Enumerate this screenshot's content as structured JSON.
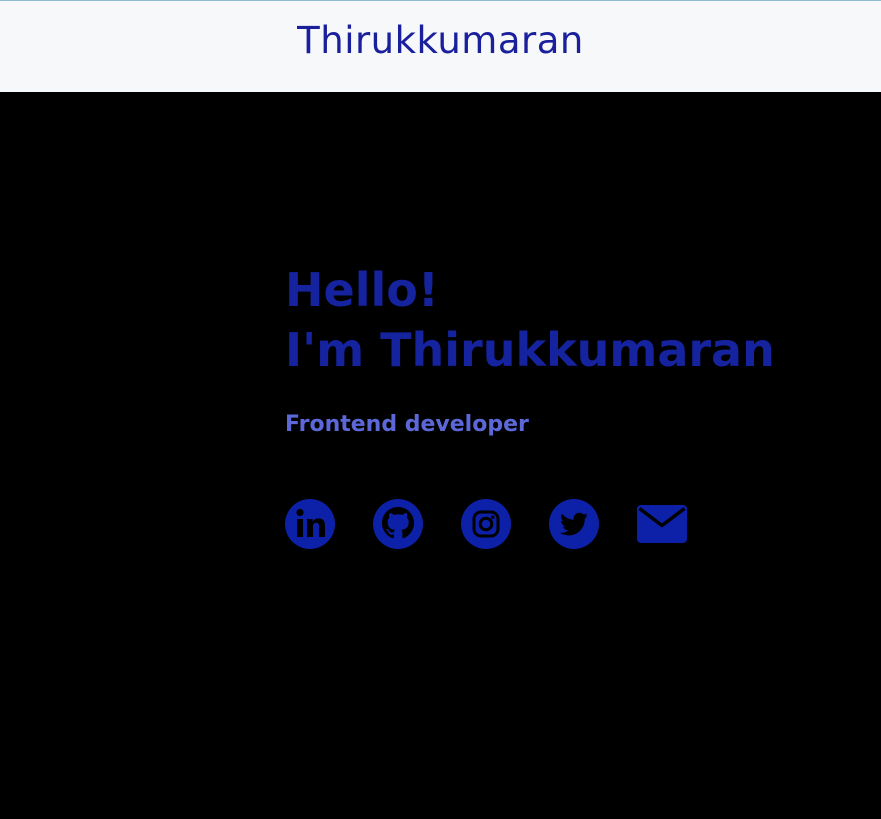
{
  "header": {
    "brand": "Thirukkumaran"
  },
  "hero": {
    "greeting_line1": "Hello!",
    "greeting_line2": "I'm Thirukkumaran",
    "role": "Frontend developer"
  },
  "socials": [
    {
      "icon": "linkedin-icon"
    },
    {
      "icon": "github-icon"
    },
    {
      "icon": "instagram-icon"
    },
    {
      "icon": "twitter-icon"
    },
    {
      "icon": "email-icon"
    }
  ],
  "colors": {
    "header_bg": "#f7f8fa",
    "page_bg": "#000000",
    "brand_text": "#1a1f9c",
    "heading_text": "#15239f",
    "role_text": "#5c68d8",
    "icon_fill": "#0c21a8"
  }
}
